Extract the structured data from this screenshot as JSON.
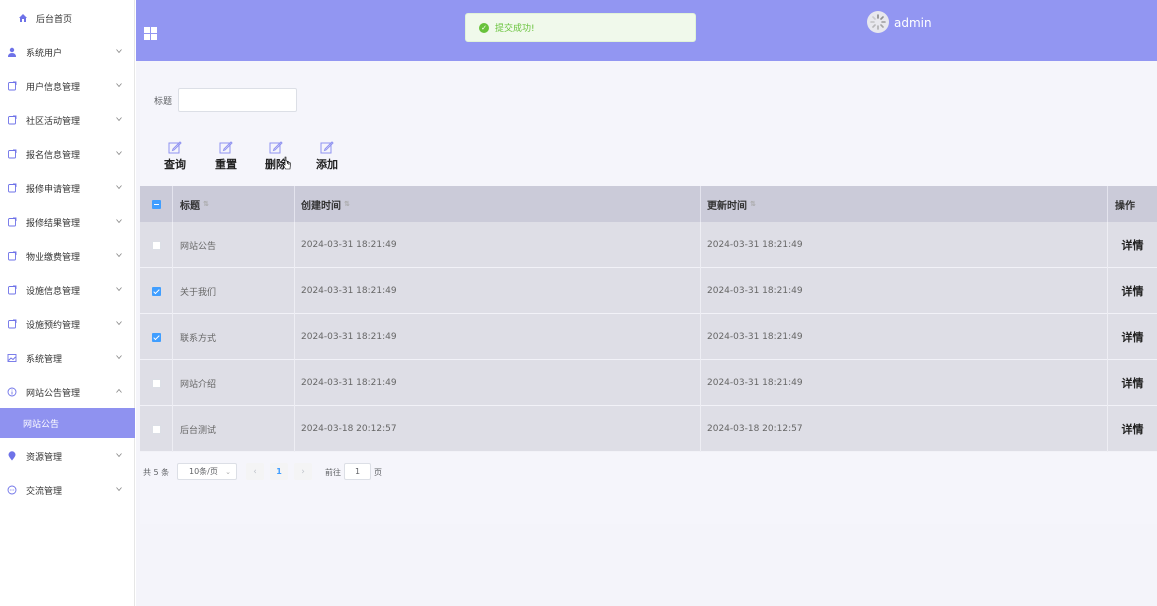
{
  "sidebar": {
    "home": "后台首页",
    "items": [
      {
        "label": "系统用户",
        "icon": "user-icon"
      },
      {
        "label": "用户信息管理",
        "icon": "doc-icon"
      },
      {
        "label": "社区活动管理",
        "icon": "doc-icon"
      },
      {
        "label": "报名信息管理",
        "icon": "doc-icon"
      },
      {
        "label": "报修申请管理",
        "icon": "doc-icon"
      },
      {
        "label": "报修结果管理",
        "icon": "doc-icon"
      },
      {
        "label": "物业缴费管理",
        "icon": "doc-icon"
      },
      {
        "label": "设施信息管理",
        "icon": "doc-icon"
      },
      {
        "label": "设施预约管理",
        "icon": "doc-icon"
      },
      {
        "label": "系统管理",
        "icon": "picture-icon"
      },
      {
        "label": "网站公告管理",
        "icon": "info-icon"
      },
      {
        "label": "资源管理",
        "icon": "location-icon"
      },
      {
        "label": "交流管理",
        "icon": "chat-icon"
      }
    ],
    "active_sub": "网站公告"
  },
  "header": {
    "toast": "提交成功!",
    "username": "admin"
  },
  "filter": {
    "label": "标题",
    "value": ""
  },
  "toolbar": {
    "query": "查询",
    "reset": "重置",
    "delete": "删除",
    "add": "添加"
  },
  "table": {
    "columns": {
      "title": "标题",
      "created": "创建时间",
      "updated": "更新时间",
      "action": "操作"
    },
    "rows": [
      {
        "checked": false,
        "title": "网站公告",
        "created": "2024-03-31 18:21:49",
        "updated": "2024-03-31 18:21:49",
        "action": "详情"
      },
      {
        "checked": true,
        "title": "关于我们",
        "created": "2024-03-31 18:21:49",
        "updated": "2024-03-31 18:21:49",
        "action": "详情"
      },
      {
        "checked": true,
        "title": "联系方式",
        "created": "2024-03-31 18:21:49",
        "updated": "2024-03-31 18:21:49",
        "action": "详情"
      },
      {
        "checked": false,
        "title": "网站介绍",
        "created": "2024-03-31 18:21:49",
        "updated": "2024-03-31 18:21:49",
        "action": "详情"
      },
      {
        "checked": false,
        "title": "后台测试",
        "created": "2024-03-18 20:12:57",
        "updated": "2024-03-18 20:12:57",
        "action": "详情"
      }
    ]
  },
  "pagination": {
    "total": "共 5 条",
    "page_size": "10条/页",
    "current_page": "1",
    "goto_label": "前往",
    "goto_value": "1",
    "page_suffix": "页"
  },
  "colors": {
    "accent": "#9296f2",
    "active_sub_bg": "#8f92f0",
    "checkbox": "#409eff",
    "success": "#67c23a"
  }
}
